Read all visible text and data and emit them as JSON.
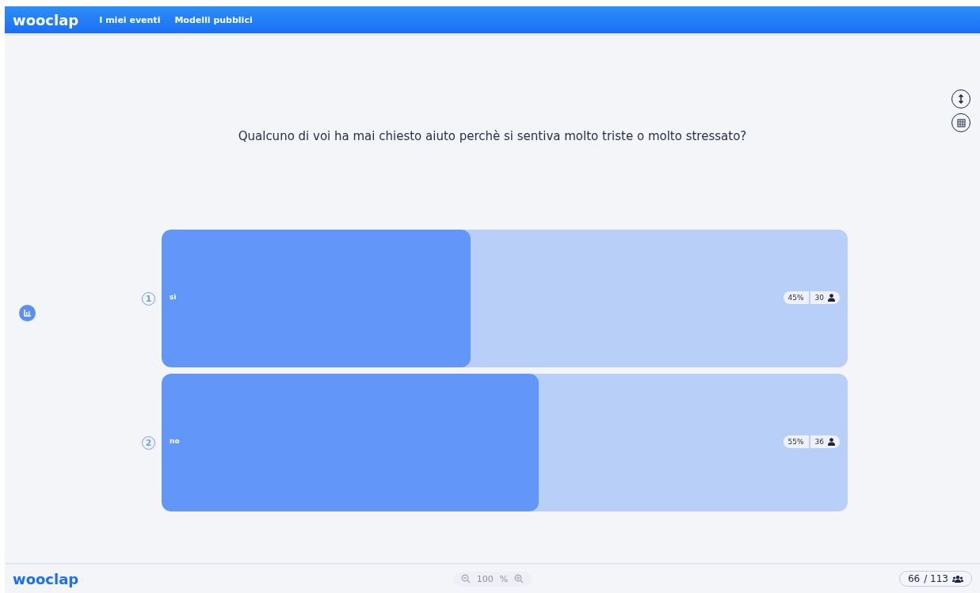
{
  "header": {
    "logo": "wooclap",
    "nav": [
      {
        "label": "I miei eventi"
      },
      {
        "label": "Modelli pubblici"
      }
    ]
  },
  "question": "Qualcuno di voi ha mai chiesto aiuto perchè si sentiva molto triste o molto stressato?",
  "answers": [
    {
      "number": "1",
      "label": "sì",
      "level": 0.45,
      "percent": "45%",
      "count": "30"
    },
    {
      "number": "2",
      "label": "no",
      "level": 0.55,
      "percent": "55%",
      "count": "36"
    }
  ],
  "footer": {
    "logo": "wooclap",
    "zoom": {
      "value": "100",
      "unit": "%",
      "disabled": true
    },
    "participants": "66",
    "total": "/ 113"
  }
}
